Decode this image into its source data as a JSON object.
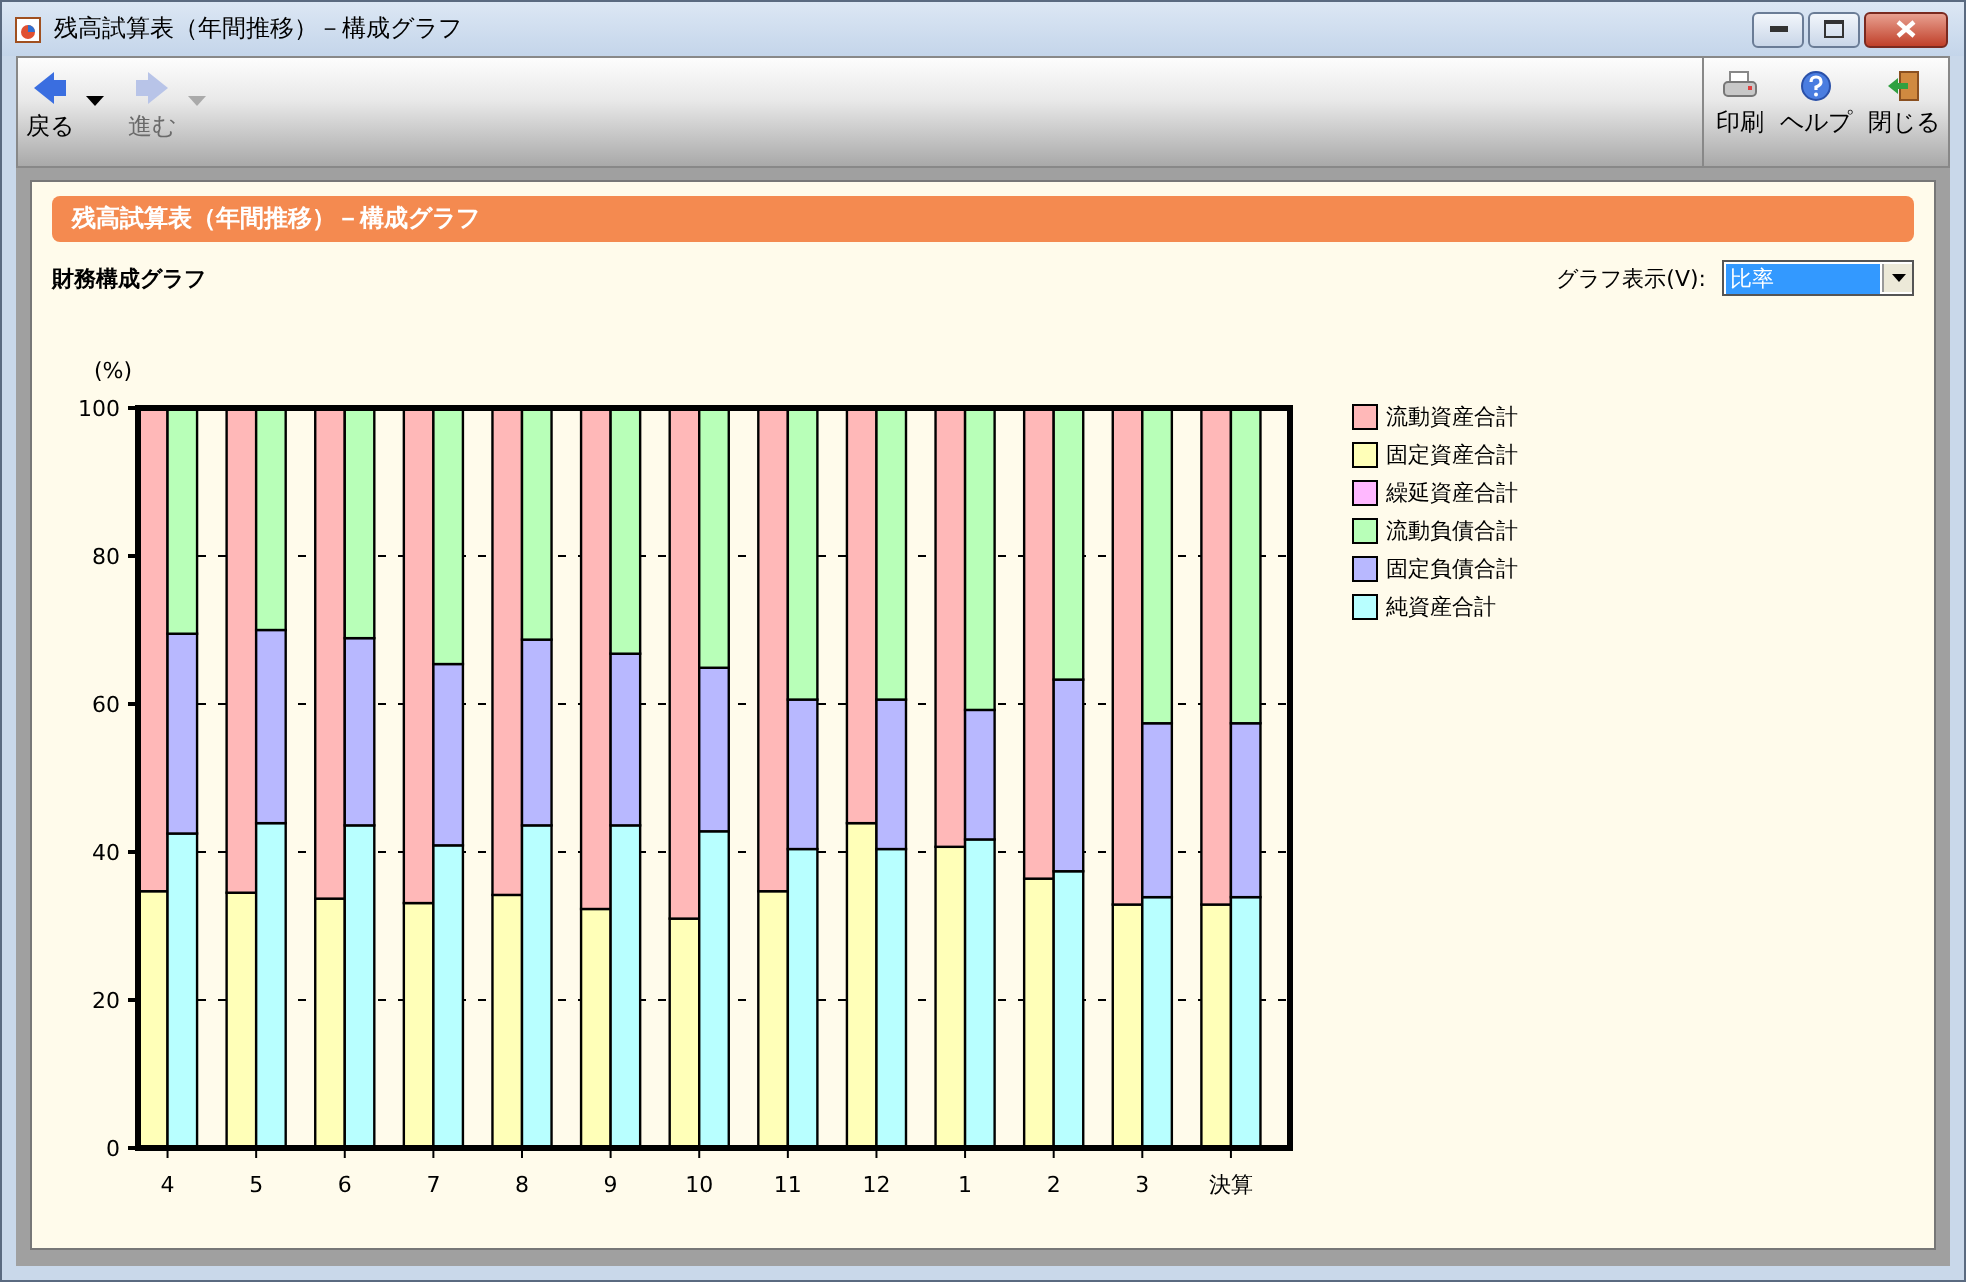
{
  "window": {
    "title": "残高試算表（年間推移）－構成グラフ"
  },
  "toolbar": {
    "left": [
      {
        "label": "戻る",
        "kind": "back",
        "disabled": false,
        "menu": true
      },
      {
        "label": "進む",
        "kind": "forward",
        "disabled": true,
        "menu": true
      }
    ],
    "right": [
      {
        "label": "印刷",
        "kind": "print",
        "disabled": false
      },
      {
        "label": "ヘルプ",
        "kind": "help",
        "disabled": false
      },
      {
        "label": "閉じる",
        "kind": "exit",
        "disabled": false
      }
    ]
  },
  "header": "残高試算表（年間推移）－構成グラフ",
  "section_title": "財務構成グラフ",
  "display_select": {
    "label": "グラフ表示(V):",
    "value": "比率"
  },
  "chart": {
    "chart_data": {
      "type": "bar",
      "stacked": true,
      "grid": true,
      "ylabel": "(%)",
      "ylim": [
        0,
        100
      ],
      "yticks": [
        0,
        20,
        40,
        60,
        80,
        100
      ],
      "categories": [
        "4",
        null,
        null,
        "5",
        null,
        null,
        "6",
        null,
        null,
        "7",
        null,
        null,
        "8",
        null,
        null,
        "9",
        null,
        null,
        "10",
        null,
        null,
        "11",
        null,
        null,
        "12",
        null,
        null,
        "1",
        null,
        null,
        "2",
        null,
        null,
        "3",
        null,
        null,
        "決算",
        null,
        null
      ],
      "series": [
        {
          "name": "流動資産合計",
          "color": "#ffb8b8",
          "values": [
            65.3,
            null,
            null,
            65.5,
            null,
            null,
            66.3,
            null,
            null,
            66.9,
            null,
            null,
            65.8,
            null,
            null,
            67.7,
            null,
            null,
            69.0,
            null,
            null,
            65.3,
            null,
            null,
            56.1,
            null,
            null,
            59.3,
            null,
            null,
            63.6,
            null,
            null,
            67.1,
            null,
            null,
            67.1,
            null,
            null
          ]
        },
        {
          "name": "固定資産合計",
          "color": "#ffffb8",
          "values": [
            34.7,
            null,
            null,
            34.5,
            null,
            null,
            33.7,
            null,
            null,
            33.1,
            null,
            null,
            34.2,
            null,
            null,
            32.3,
            null,
            null,
            31.0,
            null,
            null,
            34.7,
            null,
            null,
            43.9,
            null,
            null,
            40.7,
            null,
            null,
            36.4,
            null,
            null,
            32.9,
            null,
            null,
            32.9,
            null,
            null
          ]
        },
        {
          "name": "繰延資産合計",
          "color": "#ffb8ff",
          "values": [
            0,
            null,
            null,
            0,
            null,
            null,
            0,
            null,
            null,
            0,
            null,
            null,
            0,
            null,
            null,
            0,
            null,
            null,
            0,
            null,
            null,
            0,
            null,
            null,
            0,
            null,
            null,
            0,
            null,
            null,
            0,
            null,
            null,
            0,
            null,
            null,
            0,
            null,
            null
          ]
        },
        {
          "name": "流動負債合計",
          "color": "#b8ffb8",
          "values": [
            null,
            30.5,
            null,
            null,
            30.0,
            null,
            null,
            31.1,
            null,
            null,
            34.6,
            null,
            null,
            31.3,
            null,
            null,
            33.2,
            null,
            null,
            35.1,
            null,
            null,
            39.4,
            null,
            null,
            39.4,
            null,
            null,
            40.8,
            null,
            null,
            36.7,
            null,
            null,
            42.6,
            null,
            null,
            42.6,
            null
          ]
        },
        {
          "name": "固定負債合計",
          "color": "#b8b8ff",
          "values": [
            null,
            27.0,
            null,
            null,
            26.1,
            null,
            null,
            25.3,
            null,
            null,
            24.5,
            null,
            null,
            25.1,
            null,
            null,
            23.2,
            null,
            null,
            22.1,
            null,
            null,
            20.2,
            null,
            null,
            20.2,
            null,
            null,
            17.5,
            null,
            null,
            25.9,
            null,
            null,
            23.5,
            null,
            null,
            23.5,
            null
          ]
        },
        {
          "name": "純資産合計",
          "color": "#b8ffff",
          "values": [
            null,
            42.5,
            null,
            null,
            43.9,
            null,
            null,
            43.6,
            null,
            null,
            40.9,
            null,
            null,
            43.6,
            null,
            null,
            43.6,
            null,
            null,
            42.8,
            null,
            null,
            40.4,
            null,
            null,
            40.4,
            null,
            null,
            41.7,
            null,
            null,
            37.4,
            null,
            null,
            33.9,
            null,
            null,
            33.9,
            null
          ]
        }
      ]
    }
  }
}
